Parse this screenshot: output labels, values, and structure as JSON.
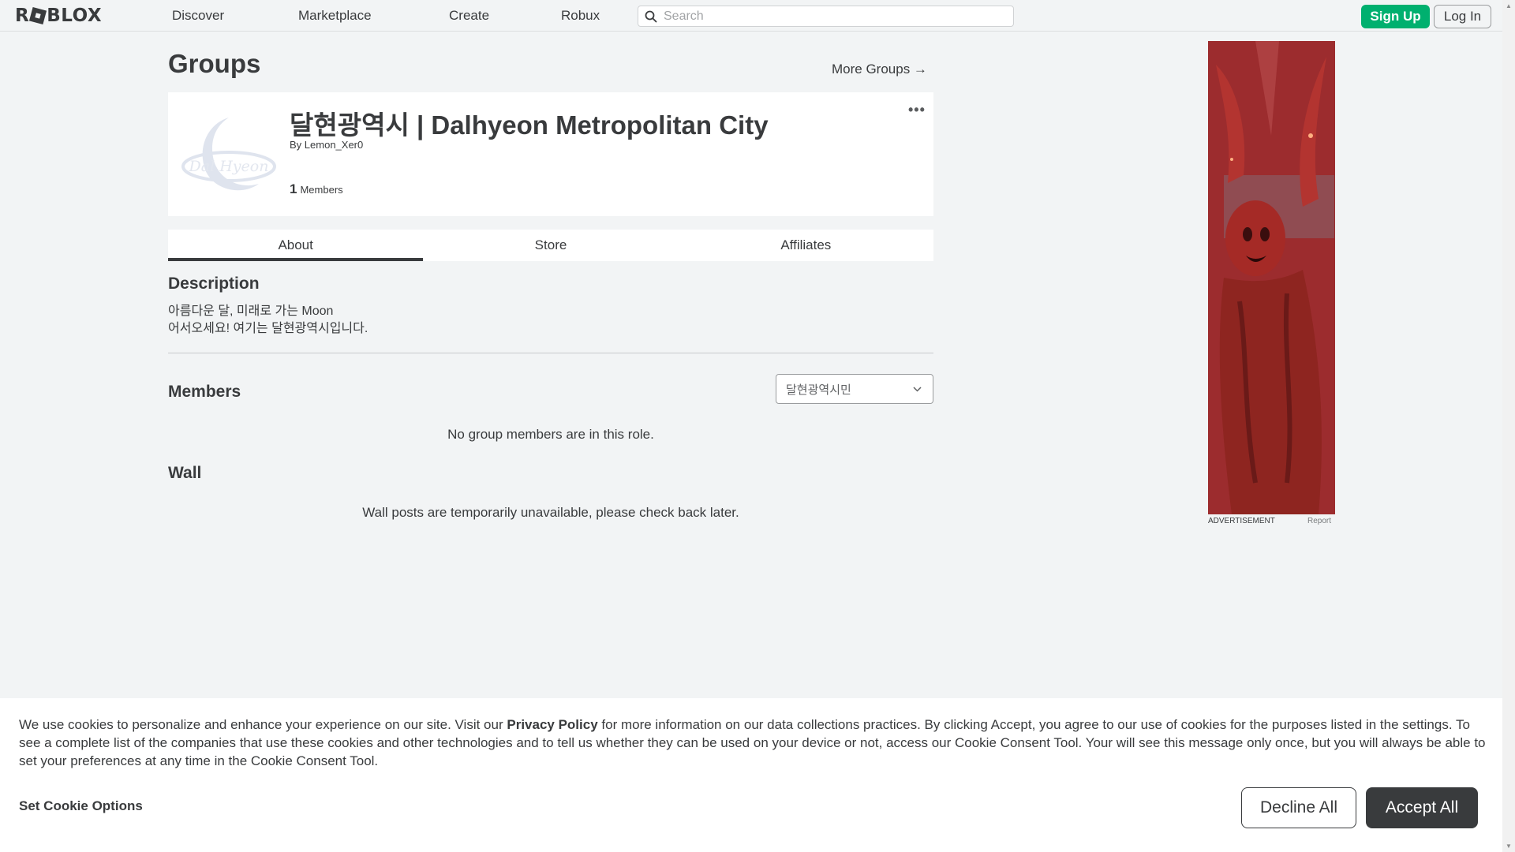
{
  "nav": {
    "logo_text": [
      "R",
      "BLOX"
    ],
    "links": [
      "Discover",
      "Marketplace",
      "Create",
      "Robux"
    ],
    "search_placeholder": "Search",
    "signup_label": "Sign Up",
    "login_label": "Log In"
  },
  "page": {
    "title": "Groups",
    "more_groups": "More Groups →"
  },
  "group": {
    "name": "달현광역시 | Dalhyeon Metropolitan City",
    "by_prefix": "By",
    "owner": "Lemon_Xer0",
    "member_count": "1",
    "members_label": "Members",
    "logo_text": "Dal Hyeon",
    "more_menu": "•••"
  },
  "tabs": [
    {
      "label": "About",
      "active": true
    },
    {
      "label": "Store",
      "active": false
    },
    {
      "label": "Affiliates",
      "active": false
    }
  ],
  "about": {
    "description_heading": "Description",
    "description_lines": [
      "아름다운 달, 미래로 가는 Moon",
      "어서오세요! 여기는 달현광역시입니다."
    ],
    "members_heading": "Members",
    "role_selected": "달현광역시민",
    "members_empty": "No group members are in this role.",
    "wall_heading": "Wall",
    "wall_empty": "Wall posts are temporarily unavailable, please check back later."
  },
  "ad": {
    "label": "ADVERTISEMENT",
    "report": "Report"
  },
  "cookie": {
    "text_before": "We use cookies to personalize and enhance your experience on our site. Visit our ",
    "privacy_link": "Privacy Policy",
    "text_after": " for more information on our data collections practices. By clicking Accept, you agree to our use of cookies for the purposes listed in the settings. To see a complete list of the companies that use these cookies and other technologies and to tell us whether they can be used on your device or not, access our Cookie Consent Tool. Your will see this message only once, but you will always be able to set your preferences at any time in the Cookie Consent Tool.",
    "options_label": "Set Cookie Options",
    "decline_label": "Decline All",
    "accept_label": "Accept All"
  },
  "colors": {
    "signup_green": "#00b06f",
    "text_dark": "#393b3d",
    "page_bg": "#f2f4f5"
  }
}
